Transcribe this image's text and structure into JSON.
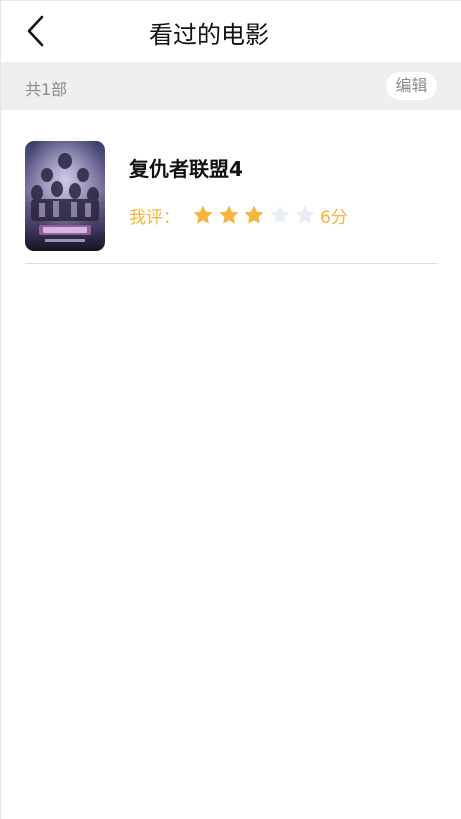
{
  "header": {
    "title": "看过的电影",
    "back_icon": "chevron-left-icon"
  },
  "summary": {
    "count_text": "共1部",
    "edit_label": "编辑"
  },
  "movies": [
    {
      "title": "复仇者联盟4",
      "rating_label": "我评：",
      "score_text": "6分",
      "stars_filled": 3,
      "stars_total": 5
    }
  ],
  "colors": {
    "accent": "#f4b63b",
    "star_empty": "#e9eef5",
    "summary_bg": "#efefef"
  }
}
